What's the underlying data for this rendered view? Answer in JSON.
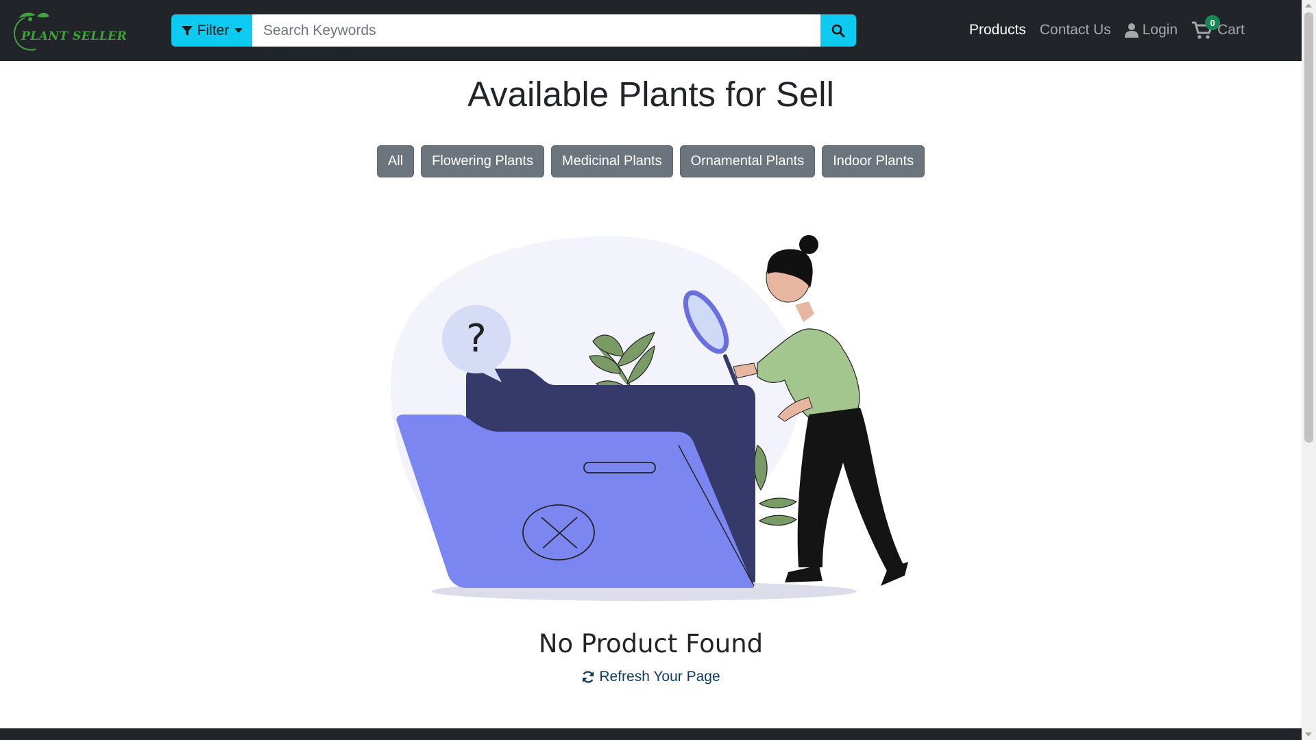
{
  "brand": {
    "logo_text": "PLANT SELLER",
    "accent": "#3fa33a"
  },
  "search": {
    "filter_label": "Filter",
    "placeholder": "Search Keywords"
  },
  "nav": {
    "products": "Products",
    "contact": "Contact Us",
    "login": "Login",
    "cart": "Cart",
    "cart_count": "0"
  },
  "main": {
    "title": "Available Plants for Sell",
    "categories": [
      "All",
      "Flowering Plants",
      "Medicinal Plants",
      "Ornamental Plants",
      "Indoor Plants"
    ],
    "empty_title": "No Product Found",
    "refresh": "Refresh Your Page",
    "illustration_glyph": "?"
  },
  "colors": {
    "navbar": "#212529",
    "search_button": "#0dcaf0",
    "category_button": "#6c757d",
    "cart_badge": "#198754"
  },
  "icons": [
    "filter-icon",
    "search-icon",
    "user-icon",
    "cart-icon",
    "refresh-icon"
  ]
}
